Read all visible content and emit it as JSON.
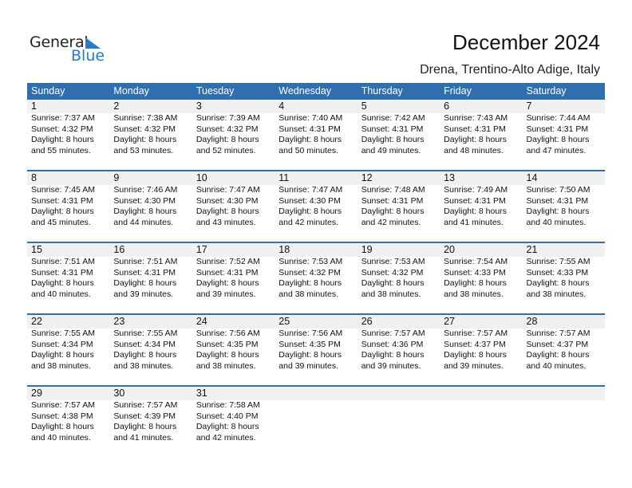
{
  "logo": {
    "word1": "General",
    "word2": "Blue"
  },
  "header": {
    "title": "December 2024",
    "location": "Drena, Trentino-Alto Adige, Italy"
  },
  "colors": {
    "accent": "#2f6faf",
    "logo_blue": "#2a7bc6",
    "date_strip": "#f0f0f0"
  },
  "weekdays": [
    "Sunday",
    "Monday",
    "Tuesday",
    "Wednesday",
    "Thursday",
    "Friday",
    "Saturday"
  ],
  "weeks": [
    [
      {
        "day": "1",
        "sunrise": "Sunrise: 7:37 AM",
        "sunset": "Sunset: 4:32 PM",
        "daylight1": "Daylight: 8 hours",
        "daylight2": "and 55 minutes."
      },
      {
        "day": "2",
        "sunrise": "Sunrise: 7:38 AM",
        "sunset": "Sunset: 4:32 PM",
        "daylight1": "Daylight: 8 hours",
        "daylight2": "and 53 minutes."
      },
      {
        "day": "3",
        "sunrise": "Sunrise: 7:39 AM",
        "sunset": "Sunset: 4:32 PM",
        "daylight1": "Daylight: 8 hours",
        "daylight2": "and 52 minutes."
      },
      {
        "day": "4",
        "sunrise": "Sunrise: 7:40 AM",
        "sunset": "Sunset: 4:31 PM",
        "daylight1": "Daylight: 8 hours",
        "daylight2": "and 50 minutes."
      },
      {
        "day": "5",
        "sunrise": "Sunrise: 7:42 AM",
        "sunset": "Sunset: 4:31 PM",
        "daylight1": "Daylight: 8 hours",
        "daylight2": "and 49 minutes."
      },
      {
        "day": "6",
        "sunrise": "Sunrise: 7:43 AM",
        "sunset": "Sunset: 4:31 PM",
        "daylight1": "Daylight: 8 hours",
        "daylight2": "and 48 minutes."
      },
      {
        "day": "7",
        "sunrise": "Sunrise: 7:44 AM",
        "sunset": "Sunset: 4:31 PM",
        "daylight1": "Daylight: 8 hours",
        "daylight2": "and 47 minutes."
      }
    ],
    [
      {
        "day": "8",
        "sunrise": "Sunrise: 7:45 AM",
        "sunset": "Sunset: 4:31 PM",
        "daylight1": "Daylight: 8 hours",
        "daylight2": "and 45 minutes."
      },
      {
        "day": "9",
        "sunrise": "Sunrise: 7:46 AM",
        "sunset": "Sunset: 4:30 PM",
        "daylight1": "Daylight: 8 hours",
        "daylight2": "and 44 minutes."
      },
      {
        "day": "10",
        "sunrise": "Sunrise: 7:47 AM",
        "sunset": "Sunset: 4:30 PM",
        "daylight1": "Daylight: 8 hours",
        "daylight2": "and 43 minutes."
      },
      {
        "day": "11",
        "sunrise": "Sunrise: 7:47 AM",
        "sunset": "Sunset: 4:30 PM",
        "daylight1": "Daylight: 8 hours",
        "daylight2": "and 42 minutes."
      },
      {
        "day": "12",
        "sunrise": "Sunrise: 7:48 AM",
        "sunset": "Sunset: 4:31 PM",
        "daylight1": "Daylight: 8 hours",
        "daylight2": "and 42 minutes."
      },
      {
        "day": "13",
        "sunrise": "Sunrise: 7:49 AM",
        "sunset": "Sunset: 4:31 PM",
        "daylight1": "Daylight: 8 hours",
        "daylight2": "and 41 minutes."
      },
      {
        "day": "14",
        "sunrise": "Sunrise: 7:50 AM",
        "sunset": "Sunset: 4:31 PM",
        "daylight1": "Daylight: 8 hours",
        "daylight2": "and 40 minutes."
      }
    ],
    [
      {
        "day": "15",
        "sunrise": "Sunrise: 7:51 AM",
        "sunset": "Sunset: 4:31 PM",
        "daylight1": "Daylight: 8 hours",
        "daylight2": "and 40 minutes."
      },
      {
        "day": "16",
        "sunrise": "Sunrise: 7:51 AM",
        "sunset": "Sunset: 4:31 PM",
        "daylight1": "Daylight: 8 hours",
        "daylight2": "and 39 minutes."
      },
      {
        "day": "17",
        "sunrise": "Sunrise: 7:52 AM",
        "sunset": "Sunset: 4:31 PM",
        "daylight1": "Daylight: 8 hours",
        "daylight2": "and 39 minutes."
      },
      {
        "day": "18",
        "sunrise": "Sunrise: 7:53 AM",
        "sunset": "Sunset: 4:32 PM",
        "daylight1": "Daylight: 8 hours",
        "daylight2": "and 38 minutes."
      },
      {
        "day": "19",
        "sunrise": "Sunrise: 7:53 AM",
        "sunset": "Sunset: 4:32 PM",
        "daylight1": "Daylight: 8 hours",
        "daylight2": "and 38 minutes."
      },
      {
        "day": "20",
        "sunrise": "Sunrise: 7:54 AM",
        "sunset": "Sunset: 4:33 PM",
        "daylight1": "Daylight: 8 hours",
        "daylight2": "and 38 minutes."
      },
      {
        "day": "21",
        "sunrise": "Sunrise: 7:55 AM",
        "sunset": "Sunset: 4:33 PM",
        "daylight1": "Daylight: 8 hours",
        "daylight2": "and 38 minutes."
      }
    ],
    [
      {
        "day": "22",
        "sunrise": "Sunrise: 7:55 AM",
        "sunset": "Sunset: 4:34 PM",
        "daylight1": "Daylight: 8 hours",
        "daylight2": "and 38 minutes."
      },
      {
        "day": "23",
        "sunrise": "Sunrise: 7:55 AM",
        "sunset": "Sunset: 4:34 PM",
        "daylight1": "Daylight: 8 hours",
        "daylight2": "and 38 minutes."
      },
      {
        "day": "24",
        "sunrise": "Sunrise: 7:56 AM",
        "sunset": "Sunset: 4:35 PM",
        "daylight1": "Daylight: 8 hours",
        "daylight2": "and 38 minutes."
      },
      {
        "day": "25",
        "sunrise": "Sunrise: 7:56 AM",
        "sunset": "Sunset: 4:35 PM",
        "daylight1": "Daylight: 8 hours",
        "daylight2": "and 39 minutes."
      },
      {
        "day": "26",
        "sunrise": "Sunrise: 7:57 AM",
        "sunset": "Sunset: 4:36 PM",
        "daylight1": "Daylight: 8 hours",
        "daylight2": "and 39 minutes."
      },
      {
        "day": "27",
        "sunrise": "Sunrise: 7:57 AM",
        "sunset": "Sunset: 4:37 PM",
        "daylight1": "Daylight: 8 hours",
        "daylight2": "and 39 minutes."
      },
      {
        "day": "28",
        "sunrise": "Sunrise: 7:57 AM",
        "sunset": "Sunset: 4:37 PM",
        "daylight1": "Daylight: 8 hours",
        "daylight2": "and 40 minutes."
      }
    ],
    [
      {
        "day": "29",
        "sunrise": "Sunrise: 7:57 AM",
        "sunset": "Sunset: 4:38 PM",
        "daylight1": "Daylight: 8 hours",
        "daylight2": "and 40 minutes."
      },
      {
        "day": "30",
        "sunrise": "Sunrise: 7:57 AM",
        "sunset": "Sunset: 4:39 PM",
        "daylight1": "Daylight: 8 hours",
        "daylight2": "and 41 minutes."
      },
      {
        "day": "31",
        "sunrise": "Sunrise: 7:58 AM",
        "sunset": "Sunset: 4:40 PM",
        "daylight1": "Daylight: 8 hours",
        "daylight2": "and 42 minutes."
      },
      null,
      null,
      null,
      null
    ]
  ]
}
